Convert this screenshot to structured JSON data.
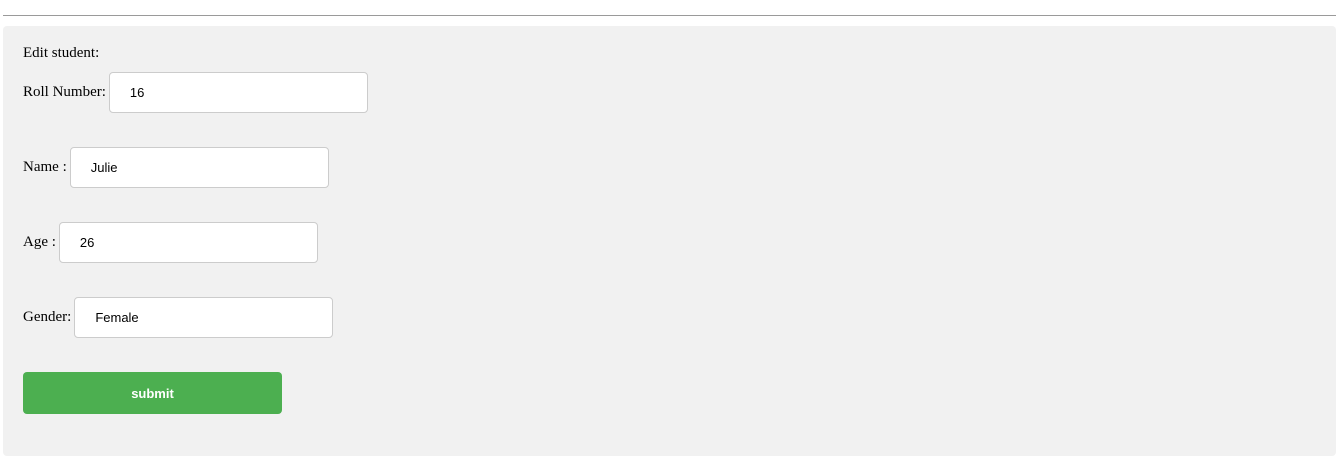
{
  "form": {
    "heading": "Edit student:",
    "fields": [
      {
        "label": "Roll Number:",
        "value": "16"
      },
      {
        "label": "Name :",
        "value": "Julie"
      },
      {
        "label": "Age :",
        "value": "26"
      },
      {
        "label": "Gender:",
        "value": "Female"
      }
    ],
    "submit_label": "submit"
  },
  "colors": {
    "panel_background": "#f1f1f1",
    "submit_button": "#4caf50",
    "submit_text": "#ffffff"
  }
}
